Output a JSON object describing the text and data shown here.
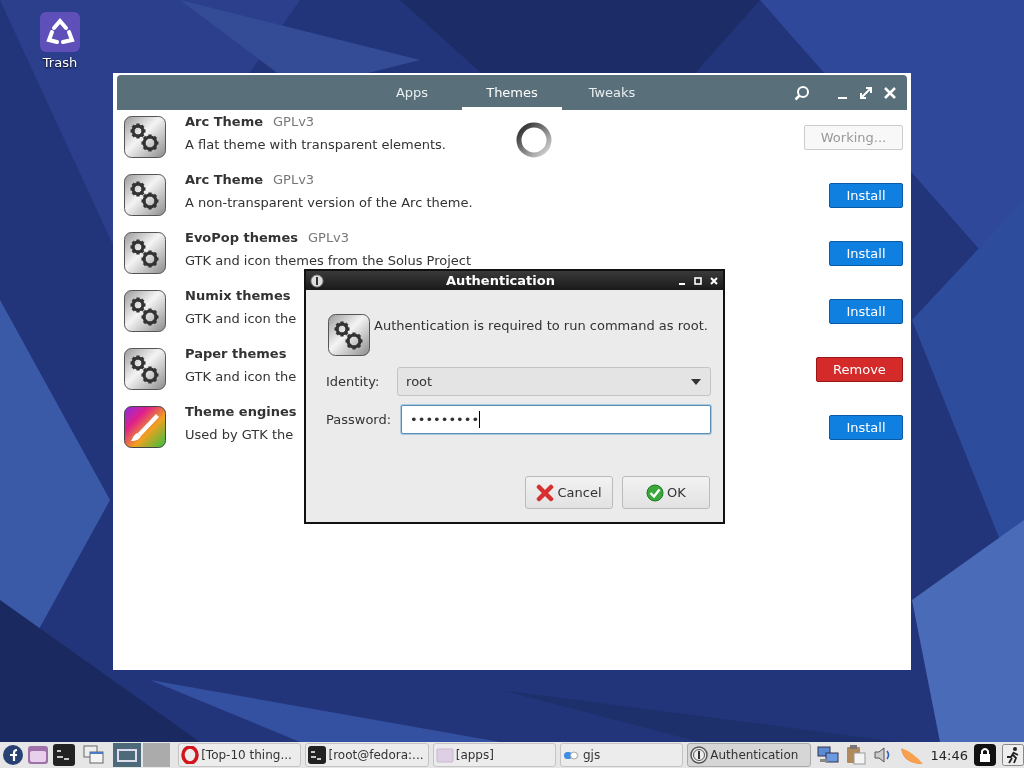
{
  "desktop": {
    "icons": [
      {
        "label": "Trash"
      }
    ]
  },
  "app_window": {
    "tabs": [
      {
        "label": "Apps",
        "selected": false
      },
      {
        "label": "Themes",
        "selected": true
      },
      {
        "label": "Tweaks",
        "selected": false
      }
    ],
    "busy": true,
    "rows": [
      {
        "kind": "gears",
        "title": "Arc Theme",
        "license": "GPLv3",
        "description": "A flat theme with transparent elements.",
        "action": {
          "label": "Working...",
          "kind": "working"
        }
      },
      {
        "kind": "gears",
        "title": "Arc Theme",
        "license": "GPLv3",
        "description": "A non-transparent version of the Arc theme.",
        "action": {
          "label": "Install",
          "kind": "install"
        }
      },
      {
        "kind": "gears",
        "title": "EvoPop themes",
        "license": "GPLv3",
        "description": "GTK and icon themes from the Solus Project",
        "action": {
          "label": "Install",
          "kind": "install"
        }
      },
      {
        "kind": "gears",
        "title": "Numix themes",
        "description": "GTK and icon the",
        "action": {
          "label": "Install",
          "kind": "install"
        }
      },
      {
        "kind": "gears",
        "title": "Paper themes",
        "description": "GTK and icon the",
        "action": {
          "label": "Remove",
          "kind": "remove"
        }
      },
      {
        "kind": "brush",
        "title": "Theme engines",
        "description": "Used by GTK the",
        "action": {
          "label": "Install",
          "kind": "install"
        }
      }
    ]
  },
  "dialog": {
    "title": "Authentication",
    "message": "Authentication is required to run command as root.",
    "identity": {
      "label": "Identity:",
      "value": "root"
    },
    "password": {
      "label": "Password:",
      "value": "•••••••••",
      "focused": true
    },
    "buttons": [
      {
        "label": "Cancel",
        "kind": "cancel"
      },
      {
        "label": "OK",
        "kind": "ok"
      }
    ]
  },
  "taskbar": {
    "workspaces": [
      {
        "selected": true
      },
      {
        "selected": false
      }
    ],
    "tasks": [
      {
        "label": "[Top-10 thing...",
        "kind": "browser",
        "selected": false
      },
      {
        "label": "[root@fedora:...",
        "kind": "terminal",
        "selected": false
      },
      {
        "label": "[apps]",
        "kind": "folder",
        "selected": false
      },
      {
        "label": "gjs",
        "kind": "toggle",
        "selected": false
      },
      {
        "label": "Authentication",
        "kind": "info",
        "selected": true
      }
    ],
    "clock": "14:46"
  }
}
